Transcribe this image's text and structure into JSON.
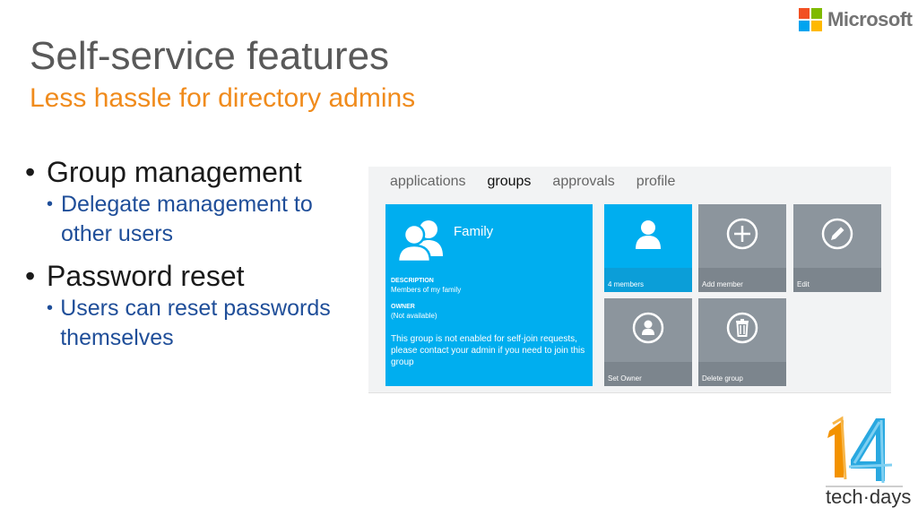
{
  "slide": {
    "title": "Self-service features",
    "subtitle": "Less hassle for directory admins"
  },
  "brand": {
    "name": "Microsoft",
    "colors": [
      "#f25022",
      "#7fba00",
      "#00a4ef",
      "#ffb900"
    ]
  },
  "bullets": [
    {
      "text": "Group management",
      "sub": [
        "Delegate management to other users"
      ]
    },
    {
      "text": "Password reset",
      "sub": [
        "Users can reset passwords themselves"
      ]
    }
  ],
  "app": {
    "tabs": [
      {
        "label": "applications",
        "active": false
      },
      {
        "label": "groups",
        "active": true
      },
      {
        "label": "approvals",
        "active": false
      },
      {
        "label": "profile",
        "active": false
      }
    ],
    "group": {
      "name": "Family",
      "description_label": "DESCRIPTION",
      "description": "Members of my family",
      "owner_label": "OWNER",
      "owner": "(Not available)",
      "message": "This group is not enabled for self-join requests, please contact your admin if you need to join this group"
    },
    "tiles": [
      {
        "label": "4 members",
        "icon": "person-icon"
      },
      {
        "label": "Add member",
        "icon": "plus-circle-icon"
      },
      {
        "label": "Edit",
        "icon": "pencil-circle-icon"
      },
      {
        "label": "Set Owner",
        "icon": "owner-circle-icon"
      },
      {
        "label": "Delete group",
        "icon": "trash-circle-icon"
      }
    ],
    "accent": "#00aeef",
    "tile_color": "#8c959d"
  },
  "event": {
    "number": "14",
    "name": "tech·days"
  }
}
